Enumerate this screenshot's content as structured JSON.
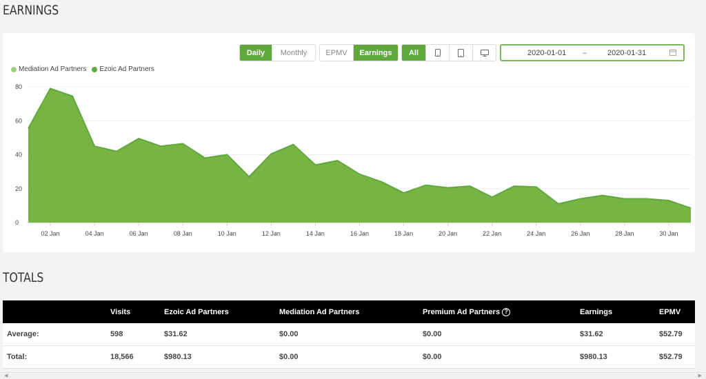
{
  "earnings_title": "EARNINGS",
  "totals_title": "TOTALS",
  "controls": {
    "period": [
      {
        "label": "Daily",
        "active": true
      },
      {
        "label": "Monthly",
        "active": false
      }
    ],
    "metric": [
      {
        "label": "EPMV",
        "active": false
      },
      {
        "label": "Earnings",
        "active": true
      }
    ],
    "device": [
      {
        "label": "All",
        "icon": "",
        "active": true
      },
      {
        "label": "",
        "icon": "mobile-icon",
        "active": false
      },
      {
        "label": "",
        "icon": "tablet-icon",
        "active": false
      },
      {
        "label": "",
        "icon": "desktop-icon",
        "active": false
      }
    ],
    "date_start": "2020-01-01",
    "date_separator": "–",
    "date_end": "2020-01-31",
    "calendar_icon": "calendar-icon"
  },
  "colors": {
    "accent": "#5ea83d",
    "area_fill": "#78b444",
    "area_line": "#5ea83d",
    "mediation": "#9fcf7e"
  },
  "chart_data": {
    "type": "area",
    "legend": [
      {
        "name": "Mediation Ad Partners",
        "color": "#9fcf7e"
      },
      {
        "name": "Ezoic Ad Partners",
        "color": "#5ea83d"
      }
    ],
    "legend_position": "top-left",
    "x_ticks": [
      "02 Jan",
      "04 Jan",
      "06 Jan",
      "08 Jan",
      "10 Jan",
      "12 Jan",
      "14 Jan",
      "16 Jan",
      "18 Jan",
      "20 Jan",
      "22 Jan",
      "24 Jan",
      "26 Jan",
      "28 Jan",
      "30 Jan"
    ],
    "y_ticks": [
      0,
      20,
      40,
      60,
      80
    ],
    "ylim": [
      0,
      80
    ],
    "grid": true,
    "series": [
      {
        "name": "Ezoic Ad Partners",
        "x": [
          "2020-01-01",
          "2020-01-02",
          "2020-01-03",
          "2020-01-04",
          "2020-01-05",
          "2020-01-06",
          "2020-01-07",
          "2020-01-08",
          "2020-01-09",
          "2020-01-10",
          "2020-01-11",
          "2020-01-12",
          "2020-01-13",
          "2020-01-14",
          "2020-01-15",
          "2020-01-16",
          "2020-01-17",
          "2020-01-18",
          "2020-01-19",
          "2020-01-20",
          "2020-01-21",
          "2020-01-22",
          "2020-01-23",
          "2020-01-24",
          "2020-01-25",
          "2020-01-26",
          "2020-01-27",
          "2020-01-28",
          "2020-01-29",
          "2020-01-30",
          "2020-01-31"
        ],
        "values": [
          55.5,
          79,
          74.5,
          45,
          42,
          49.5,
          45,
          46.5,
          38,
          40,
          27,
          40.5,
          46,
          34,
          36.5,
          28.5,
          24,
          17.5,
          22,
          20.5,
          21.5,
          15,
          21.5,
          21,
          11,
          14,
          16,
          14,
          14,
          13,
          8.5
        ]
      },
      {
        "name": "Mediation Ad Partners",
        "x": [],
        "values": []
      }
    ]
  },
  "table": {
    "headers": [
      "",
      "Visits",
      "Ezoic Ad Partners",
      "Mediation Ad Partners",
      "Premium Ad Partners",
      "Earnings",
      "EPMV"
    ],
    "help_icon": "?",
    "rows": [
      [
        "Average:",
        "598",
        "$31.62",
        "$0.00",
        "$0.00",
        "$31.62",
        "$52.79"
      ],
      [
        "Total:",
        "18,566",
        "$980.13",
        "$0.00",
        "$0.00",
        "$980.13",
        "$52.79"
      ]
    ]
  },
  "scrollbar": {
    "left_arrow": "◀",
    "right_arrow": "▶"
  }
}
